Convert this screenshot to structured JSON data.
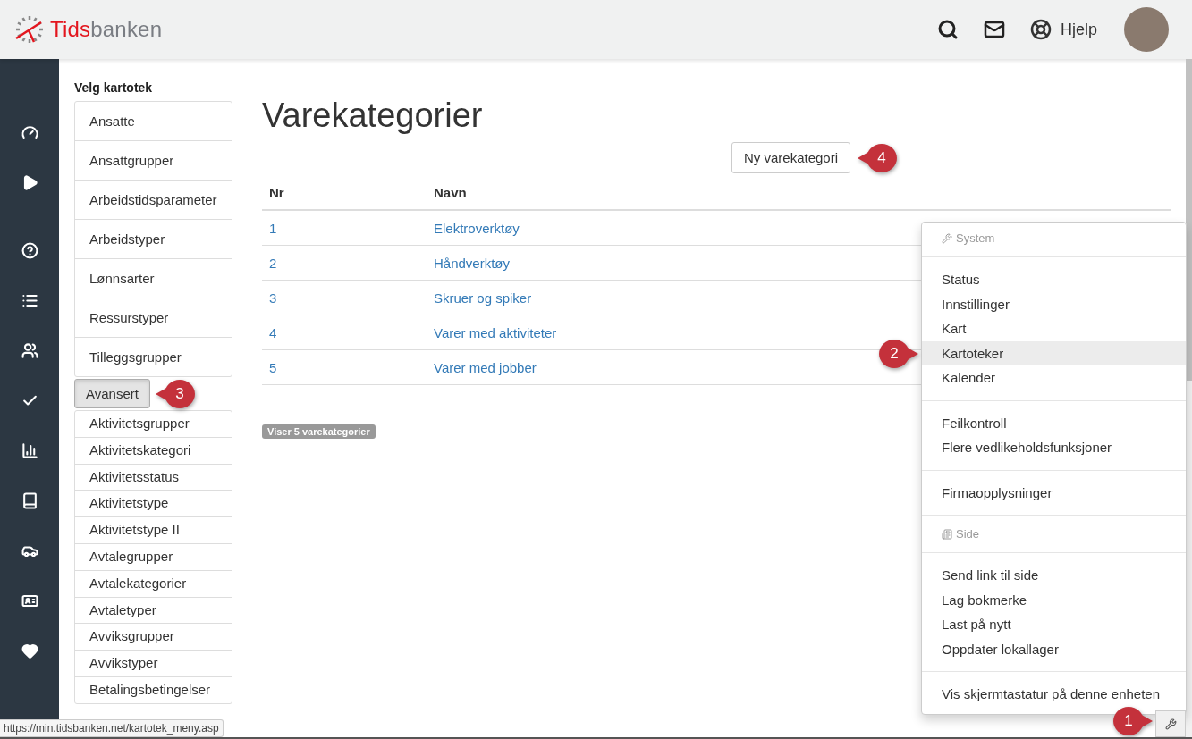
{
  "header": {
    "brand_primary": "Tids",
    "brand_secondary": "banken",
    "help_label": "Hjelp"
  },
  "nav": {
    "items": [
      {
        "kind": "gauge"
      },
      {
        "kind": "play"
      },
      {
        "kind": "help"
      },
      {
        "kind": "list"
      },
      {
        "kind": "users"
      },
      {
        "kind": "check"
      },
      {
        "kind": "chart"
      },
      {
        "kind": "book"
      },
      {
        "kind": "car"
      },
      {
        "kind": "card"
      },
      {
        "kind": "heart"
      }
    ]
  },
  "sidebar": {
    "title": "Velg kartotek",
    "items": [
      {
        "label": "Ansatte"
      },
      {
        "label": "Ansattgrupper"
      },
      {
        "label": "Arbeidstidsparameter"
      },
      {
        "label": "Arbeidstyper"
      },
      {
        "label": "Lønnsarter"
      },
      {
        "label": "Ressurstyper"
      },
      {
        "label": "Tilleggsgrupper"
      }
    ],
    "advanced_button": {
      "label": "Avansert",
      "callout": "3"
    },
    "advanced_items": [
      {
        "label": "Aktivitetsgrupper"
      },
      {
        "label": "Aktivitetskategori"
      },
      {
        "label": "Aktivitetsstatus"
      },
      {
        "label": "Aktivitetstype"
      },
      {
        "label": "Aktivitetstype II"
      },
      {
        "label": "Avtalegrupper"
      },
      {
        "label": "Avtalekategorier"
      },
      {
        "label": "Avtaletyper"
      },
      {
        "label": "Avviksgrupper"
      },
      {
        "label": "Avvikstyper"
      },
      {
        "label": "Betalingsbetingelser"
      }
    ]
  },
  "main": {
    "title": "Varekategorier",
    "new_button": {
      "label": "Ny varekategori",
      "callout": "4"
    },
    "table": {
      "columns": [
        "Nr",
        "Navn"
      ],
      "rows": [
        {
          "nr": "1",
          "name": "Elektroverktøy"
        },
        {
          "nr": "2",
          "name": "Håndverktøy"
        },
        {
          "nr": "3",
          "name": "Skruer og spiker"
        },
        {
          "nr": "4",
          "name": "Varer med aktiviteter"
        },
        {
          "nr": "5",
          "name": "Varer med jobber"
        }
      ]
    },
    "count_badge": "Viser 5 varekategorier"
  },
  "menu": {
    "groups": [
      {
        "kind": "header",
        "label": "System"
      },
      {
        "kind": "items",
        "items": [
          {
            "label": "Status",
            "selected": false
          },
          {
            "label": "Innstillinger",
            "selected": false
          },
          {
            "label": "Kart",
            "selected": false
          },
          {
            "label": "Kartoteker",
            "selected": true,
            "callout": "2"
          },
          {
            "label": "Kalender",
            "selected": false
          }
        ]
      },
      {
        "kind": "items",
        "items": [
          {
            "label": "Feilkontroll",
            "selected": false
          },
          {
            "label": "Flere vedlikeholdsfunksjoner",
            "selected": false
          }
        ]
      },
      {
        "kind": "items",
        "items": [
          {
            "label": "Firmaopplysninger",
            "selected": false
          }
        ]
      },
      {
        "kind": "header",
        "label": "Side"
      },
      {
        "kind": "items",
        "items": [
          {
            "label": "Send link til side",
            "selected": false
          },
          {
            "label": "Lag bokmerke",
            "selected": false
          },
          {
            "label": "Last på nytt",
            "selected": false
          },
          {
            "label": "Oppdater lokallager",
            "selected": false
          }
        ]
      },
      {
        "kind": "items",
        "items": [
          {
            "label": "Vis skjermtastatur på denne enheten",
            "selected": false
          }
        ]
      }
    ]
  },
  "tools_button": {
    "callout": "1"
  },
  "status_url": "https://min.tidsbanken.net/kartotek_meny.asp"
}
